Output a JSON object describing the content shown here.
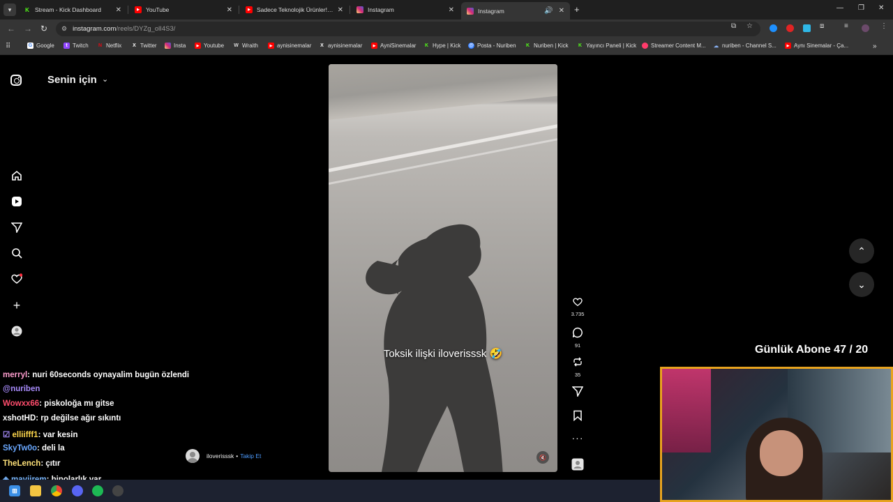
{
  "tabs": [
    {
      "label": "Stream - Kick Dashboard",
      "icon": "kick-icon",
      "color": "#53fc18"
    },
    {
      "label": "YouTube",
      "icon": "youtube-icon",
      "color": "#ff0000"
    },
    {
      "label": "Sadece Teknolojik Ürünler! Top",
      "icon": "youtube-icon",
      "color": "#ff0000"
    },
    {
      "label": "Instagram",
      "icon": "instagram-icon",
      "color": "#e1306c"
    },
    {
      "label": "Instagram",
      "icon": "instagram-icon",
      "color": "#e1306c",
      "active": true
    }
  ],
  "address": {
    "host": "instagram.com",
    "path": "/reels/DYZg_olI4S3/"
  },
  "bookmarks": [
    {
      "label": "Google",
      "icon": "google-icon",
      "color": "#4285f4"
    },
    {
      "label": "Twitch",
      "icon": "twitch-icon",
      "color": "#9146ff"
    },
    {
      "label": "Netflix",
      "icon": "netflix-icon",
      "color": "#e50914"
    },
    {
      "label": "Twitter",
      "icon": "x-icon",
      "color": "#ffffff"
    },
    {
      "label": "Insta",
      "icon": "instagram-icon",
      "color": "#e1306c"
    },
    {
      "label": "Youtube",
      "icon": "youtube-icon",
      "color": "#ff0000"
    },
    {
      "label": "Wraith",
      "icon": "wraith-icon",
      "color": "#dddddd"
    },
    {
      "label": "aynisinemalar",
      "icon": "youtube-icon",
      "color": "#ff0000"
    },
    {
      "label": "aynisinemalar",
      "icon": "x-icon",
      "color": "#ffffff"
    },
    {
      "label": "AyniSinemalar",
      "icon": "youtube-icon",
      "color": "#ff0000"
    },
    {
      "label": "Hype | Kick",
      "icon": "kick-icon",
      "color": "#53fc18"
    },
    {
      "label": "Posta - Nuriben",
      "icon": "mail-icon",
      "color": "#2f7bff"
    },
    {
      "label": "Nuriben | Kick",
      "icon": "kick-icon",
      "color": "#53fc18"
    },
    {
      "label": "Yayıncı Paneli | Kick",
      "icon": "kick-icon",
      "color": "#53fc18"
    },
    {
      "label": "Streamer Content M...",
      "icon": "content-icon",
      "color": "#ff3b6b"
    },
    {
      "label": "nuriben - Channel S...",
      "icon": "channel-icon",
      "color": "#8ab4f8"
    },
    {
      "label": "Aynı Sinemalar - Ça...",
      "icon": "youtube-icon",
      "color": "#ff0000"
    }
  ],
  "instagram": {
    "feed_title": "Senin için",
    "caption": "Toksik ilişki iloverisssk 🤣",
    "author": "iloverisssk",
    "follow_label": "Takip Et",
    "likes": "3.735",
    "comments": "91",
    "reposts": "35"
  },
  "overlay": {
    "sub_goal": "Günlük Abone 47 / 20",
    "chat": [
      {
        "user": "merryl",
        "msg": ": nuri 60seconds oynayalim bugün özlendi",
        "color": "#ff9ecf"
      },
      {
        "user": "@nuriben",
        "msg": "",
        "color": "#a78bfa"
      },
      {
        "user": "Wowxx66",
        "msg": ": piskoloğa mı gitse",
        "color": "#ff4d6d"
      },
      {
        "user": "xshotHD",
        "msg": ": rp değilse ağır sıkıntı",
        "color": "#ffffff"
      },
      {
        "user": "elliifff1",
        "msg": ": var kesin",
        "color": "#ffd84d"
      },
      {
        "user": "SkyTw0o",
        "msg": ": deli la",
        "color": "#6aa8ff"
      },
      {
        "user": "TheLench",
        "msg": ": çıtır",
        "color": "#ffe37a"
      },
      {
        "user": "maviirem",
        "msg": ": bipolarlık var",
        "color": "#7ab8ff"
      }
    ]
  }
}
